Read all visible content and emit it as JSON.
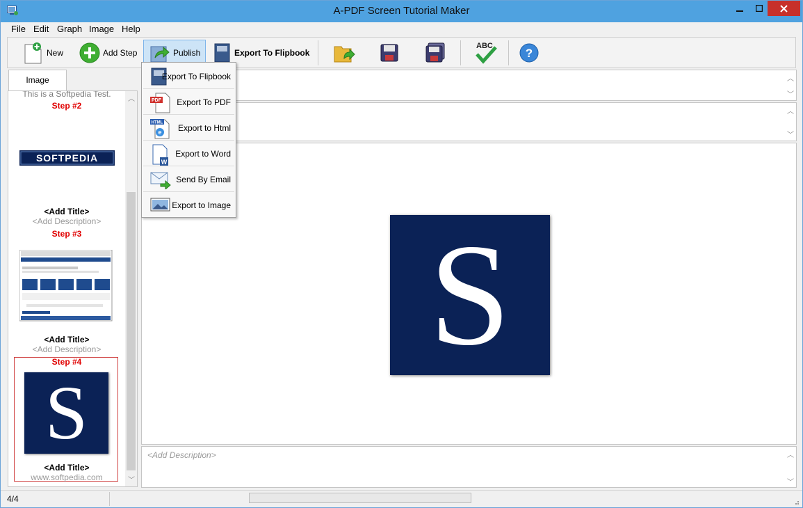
{
  "window": {
    "title": "A-PDF Screen Tutorial Maker"
  },
  "menu": [
    "File",
    "Edit",
    "Graph",
    "Image",
    "Help"
  ],
  "toolbar": {
    "new_label": "New",
    "add_step_label": "Add Step",
    "publish_label": "Publish",
    "export_flipbook_label": "Export To Flipbook"
  },
  "left_panel": {
    "tab": "Image",
    "cut_text": "This is a Softpedia Test.",
    "steps": [
      {
        "label": "Step #2",
        "title": "<Add Title>",
        "description": "<Add Description>",
        "thumb_text": "SOFTPEDIA"
      },
      {
        "label": "Step #3",
        "title": "<Add Title>",
        "description": "<Add Description>"
      },
      {
        "label": "Step #4",
        "title": "<Add Title>",
        "description": "www.softpedia.com",
        "thumb_text": "S"
      }
    ]
  },
  "dropdown": [
    {
      "label": "Export To Flipbook",
      "icon": "flipbook-icon"
    },
    {
      "label": "Export To PDF",
      "icon": "pdf-icon"
    },
    {
      "label": "Export to Html",
      "icon": "html-icon"
    },
    {
      "label": "Export to Word",
      "icon": "word-icon"
    },
    {
      "label": "Send By Email",
      "icon": "email-icon"
    },
    {
      "label": "Export to Image",
      "icon": "image-icon"
    }
  ],
  "main": {
    "image_letter": "S",
    "description_placeholder": "<Add Description>"
  },
  "status": {
    "page": "4/4"
  },
  "colors": {
    "step_red": "#e00000",
    "softpedia_blue": "#0b2256",
    "titlebar": "#4fa2e0",
    "close_red": "#c7302a"
  }
}
